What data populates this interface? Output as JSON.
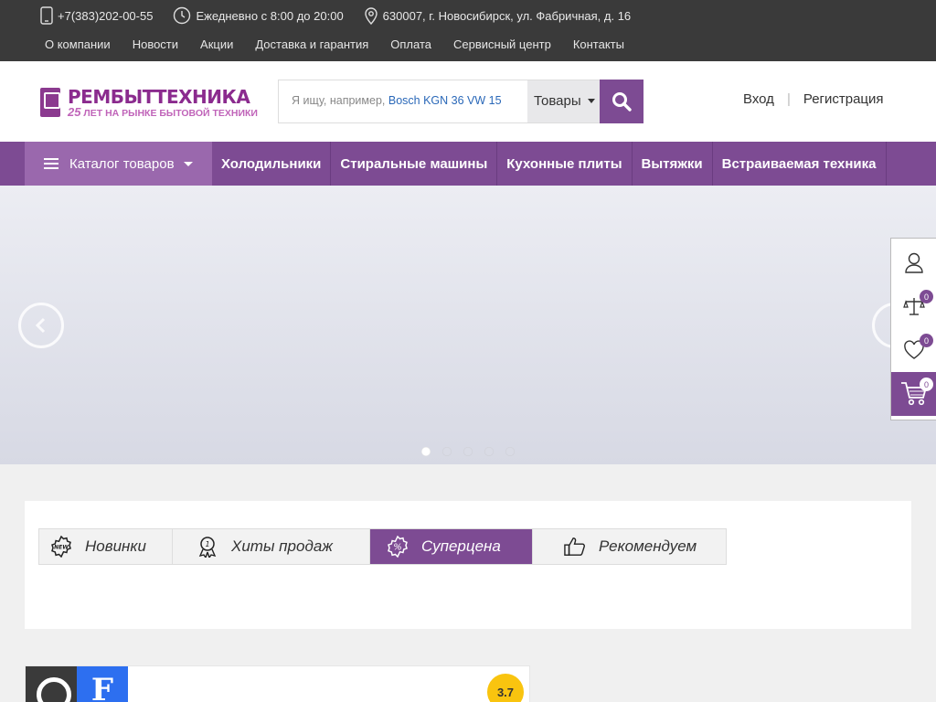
{
  "topbar": {
    "phone": "+7(383)202-00-55",
    "hours": "Ежедневно с 8:00 до 20:00",
    "address": "630007, г. Новосибирск, ул. Фабричная, д. 16",
    "menu": [
      "О компании",
      "Новости",
      "Акции",
      "Доставка и гарантия",
      "Оплата",
      "Сервисный центр",
      "Контакты"
    ]
  },
  "header": {
    "logo_name": "РЕМБЫТТЕХНИКА",
    "logo_tag_num": "25",
    "logo_tag_text": " ЛЕТ НА РЫНКЕ БЫТОВОЙ ТЕХНИКИ",
    "search_placeholder": "Я ищу, например, ",
    "search_example": "Bosch KGN 36 VW 15",
    "search_scope": "Товары",
    "login": "Вход",
    "register": "Регистрация"
  },
  "nav": {
    "catalog": "Каталог товаров",
    "items": [
      "Холодильники",
      "Стиральные машины",
      "Кухонные плиты",
      "Вытяжки",
      "Встраиваемая техника"
    ]
  },
  "slider": {
    "active_dot": 0,
    "dot_count": 5
  },
  "sidepanel": {
    "compare_count": "0",
    "favorites_count": "0",
    "cart_count": "0"
  },
  "tabs": [
    {
      "label": "Новинки",
      "icon": "new-badge-icon",
      "active": false
    },
    {
      "label": "Хиты продаж",
      "icon": "award-icon",
      "active": false
    },
    {
      "label": "Суперцена",
      "icon": "percent-icon",
      "active": true
    },
    {
      "label": "Рекомендуем",
      "icon": "thumbs-up-icon",
      "active": false
    }
  ],
  "card": {
    "rating": "3.7",
    "brand_letter": "F"
  },
  "colors": {
    "brand": "#7d4b93",
    "topbar": "#3a3a3a",
    "rating": "#f9c40f"
  }
}
